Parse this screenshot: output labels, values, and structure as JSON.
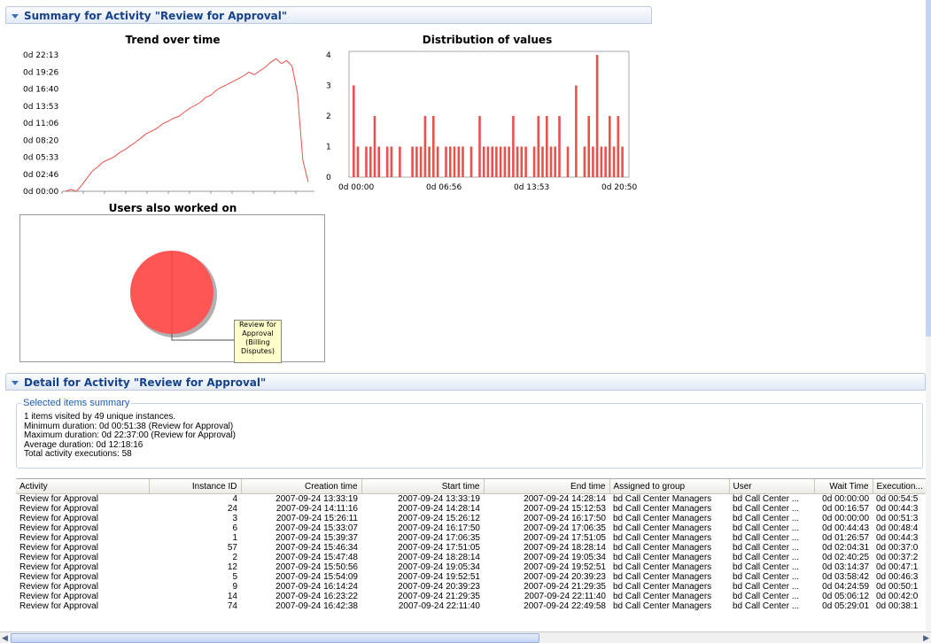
{
  "summary_header": {
    "title": "Summary for Activity \"Review for Approval\""
  },
  "trend": {
    "title": "Trend over time",
    "y_ticks": [
      "0d 22:13",
      "0d 19:26",
      "0d 16:40",
      "0d 13:53",
      "0d 11:06",
      "0d 08:20",
      "0d 05:33",
      "0d 02:46",
      "0d 00:00"
    ]
  },
  "distribution": {
    "title": "Distribution of values",
    "y_ticks": [
      "4",
      "3",
      "2",
      "1",
      "0"
    ],
    "x_ticks": [
      "0d 00:00",
      "0d 06:56",
      "0d 13:53",
      "0d 20:50"
    ]
  },
  "users_chart": {
    "title": "Users also worked on",
    "slice_label": "Review for Approval (Billing Disputes)"
  },
  "chart_data": [
    {
      "type": "line",
      "title": "Trend over time",
      "ylabel": "",
      "xlabel": "",
      "ylim": [
        "0d 00:00",
        "0d 22:13"
      ],
      "series": [
        {
          "values_hours": [
            0.0,
            0.3,
            0.0,
            1.0,
            2.2,
            3.3,
            4.0,
            4.8,
            5.2,
            5.6,
            6.3,
            6.8,
            7.4,
            8.0,
            8.7,
            9.4,
            9.8,
            10.3,
            11.0,
            11.4,
            11.9,
            12.2,
            12.9,
            13.5,
            14.0,
            14.5,
            15.3,
            15.7,
            16.5,
            17.0,
            17.4,
            17.9,
            18.3,
            18.8,
            19.4,
            19.0,
            19.6,
            20.2,
            21.0,
            21.6,
            20.8,
            21.3,
            20.4,
            16.0,
            5.0,
            1.5
          ]
        }
      ]
    },
    {
      "type": "bar",
      "title": "Distribution of values",
      "xlim": [
        "0d 00:00",
        "0d 20:50"
      ],
      "ylim": [
        0,
        4
      ],
      "values": [
        3,
        1,
        0,
        1,
        1,
        2,
        1,
        0,
        1,
        1,
        0,
        1,
        0,
        0,
        1,
        1,
        1,
        2,
        1,
        2,
        1,
        0,
        1,
        1,
        1,
        1,
        1,
        0,
        1,
        0,
        2,
        1,
        1,
        1,
        1,
        1,
        1,
        1,
        2,
        1,
        1,
        1,
        0,
        1,
        2,
        1,
        2,
        1,
        1,
        2,
        0,
        1,
        0,
        3,
        0,
        1,
        2,
        1,
        4,
        1,
        1,
        2,
        1,
        2,
        1
      ]
    },
    {
      "type": "pie",
      "title": "Users also worked on",
      "slices": [
        {
          "name": "Review for Approval (Billing Disputes)",
          "value": 100
        }
      ]
    }
  ],
  "detail_header": {
    "title": "Detail for Activity \"Review for Approval\""
  },
  "selected_summary": {
    "legend": "Selected items summary",
    "lines": [
      "1 items visited by 49 unique instances.",
      "Minimum duration: 0d 00:51:38 (Review for Approval)",
      "Maximum duration: 0d 22:37:00 (Review for Approval)",
      "Average duration: 0d 12:18:16",
      "Total activity executions: 58"
    ]
  },
  "table": {
    "columns": [
      "Activity",
      "Instance ID",
      "Creation time",
      "Start time",
      "End time",
      "Assigned to group",
      "User",
      "Wait Time",
      "Execution..."
    ],
    "rows": [
      [
        "Review for Approval",
        "4",
        "2007-09-24 13:33:19",
        "2007-09-24 13:33:19",
        "2007-09-24 14:28:14",
        "bd Call Center Managers",
        "bd Call Center ...",
        "0d 00:00:00",
        "0d 00:54:5"
      ],
      [
        "Review for Approval",
        "24",
        "2007-09-24 14:11:16",
        "2007-09-24 14:28:14",
        "2007-09-24 15:12:53",
        "bd Call Center Managers",
        "bd Call Center ...",
        "0d 00:16:57",
        "0d 00:44:3"
      ],
      [
        "Review for Approval",
        "3",
        "2007-09-24 15:26:11",
        "2007-09-24 15:26:12",
        "2007-09-24 16:17:50",
        "bd Call Center Managers",
        "bd Call Center ...",
        "0d 00:00:00",
        "0d 00:51:3"
      ],
      [
        "Review for Approval",
        "6",
        "2007-09-24 15:33:07",
        "2007-09-24 16:17:50",
        "2007-09-24 17:06:35",
        "bd Call Center Managers",
        "bd Call Center ...",
        "0d 00:44:43",
        "0d 00:48:4"
      ],
      [
        "Review for Approval",
        "1",
        "2007-09-24 15:39:37",
        "2007-09-24 17:06:35",
        "2007-09-24 17:51:05",
        "bd Call Center Managers",
        "bd Call Center ...",
        "0d 01:26:57",
        "0d 00:44:3"
      ],
      [
        "Review for Approval",
        "57",
        "2007-09-24 15:46:34",
        "2007-09-24 17:51:05",
        "2007-09-24 18:28:14",
        "bd Call Center Managers",
        "bd Call Center ...",
        "0d 02:04:31",
        "0d 00:37:0"
      ],
      [
        "Review for Approval",
        "2",
        "2007-09-24 15:47:48",
        "2007-09-24 18:28:14",
        "2007-09-24 19:05:34",
        "bd Call Center Managers",
        "bd Call Center ...",
        "0d 02:40:25",
        "0d 00:37:2"
      ],
      [
        "Review for Approval",
        "12",
        "2007-09-24 15:50:56",
        "2007-09-24 19:05:34",
        "2007-09-24 19:52:51",
        "bd Call Center Managers",
        "bd Call Center ...",
        "0d 03:14:37",
        "0d 00:47:1"
      ],
      [
        "Review for Approval",
        "5",
        "2007-09-24 15:54:09",
        "2007-09-24 19:52:51",
        "2007-09-24 20:39:23",
        "bd Call Center Managers",
        "bd Call Center ...",
        "0d 03:58:42",
        "0d 00:46:3"
      ],
      [
        "Review for Approval",
        "9",
        "2007-09-24 16:14:24",
        "2007-09-24 20:39:23",
        "2007-09-24 21:29:35",
        "bd Call Center Managers",
        "bd Call Center ...",
        "0d 04:24:59",
        "0d 00:50:1"
      ],
      [
        "Review for Approval",
        "14",
        "2007-09-24 16:23:22",
        "2007-09-24 21:29:35",
        "2007-09-24 22:11:40",
        "bd Call Center Managers",
        "bd Call Center ...",
        "0d 05:06:12",
        "0d 00:42:0"
      ],
      [
        "Review for Approval",
        "74",
        "2007-09-24 16:42:38",
        "2007-09-24 22:11:40",
        "2007-09-24 22:49:58",
        "bd Call Center Managers",
        "bd Call Center ...",
        "0d 05:29:01",
        "0d 00:38:1"
      ]
    ]
  }
}
